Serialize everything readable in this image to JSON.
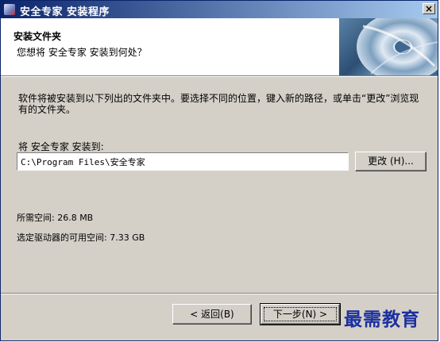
{
  "window": {
    "title": "安全专家 安装程序",
    "close_glyph": "×"
  },
  "header": {
    "title": "安装文件夹",
    "subtitle": "您想将 安全专家 安装到何处？"
  },
  "main": {
    "description": "软件将被安装到以下列出的文件夹中。要选择不同的位置，键入新的路径，或单击“更改”浏览现有的文件夹。",
    "folder_label": "将 安全专家 安装到:",
    "install_path": "C:\\Program Files\\安全专家",
    "change_button": "更改 (H)...",
    "space_required": "所需空间: 26.8 MB",
    "space_available": "选定驱动器的可用空间: 7.33 GB"
  },
  "footer": {
    "back_button": "< 返回(B)",
    "next_button": "下一步(N) >"
  },
  "watermark": "最需教育",
  "icons": {
    "app": "installer-icon",
    "banner": "cd-disc-graphic"
  },
  "colors": {
    "titlebar_start": "#0a246a",
    "titlebar_end": "#a6caf0",
    "dialog_bg": "#d4d0c8",
    "watermark": "#1b2fa0"
  }
}
